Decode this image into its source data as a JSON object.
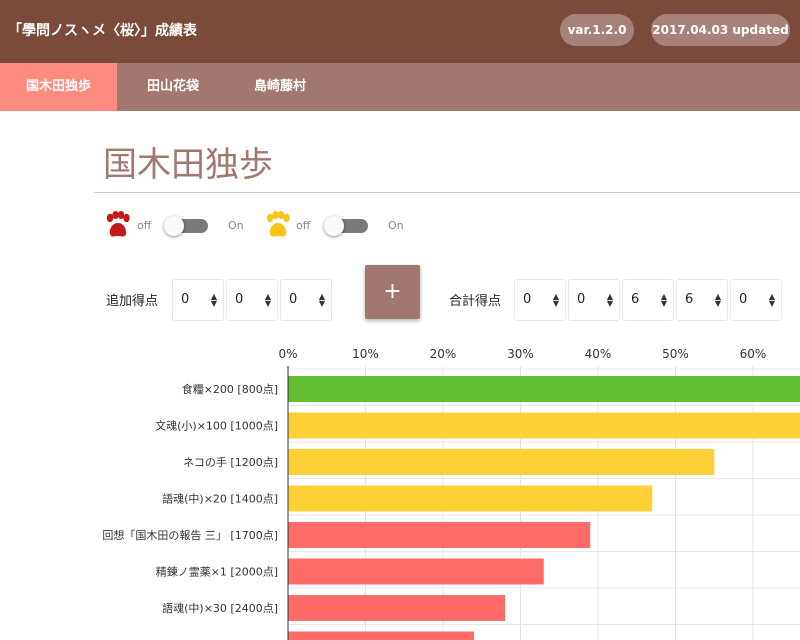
{
  "header": {
    "title": "「學問ノスヽメ〈桜〉」成績表",
    "version": "var.1.2.0",
    "updated": "2017.04.03 updated"
  },
  "tabs": [
    {
      "label": "国木田独歩",
      "active": true
    },
    {
      "label": "田山花袋",
      "active": false
    },
    {
      "label": "島崎藤村",
      "active": false
    }
  ],
  "page_title": "国木田独歩",
  "toggles": [
    {
      "icon": "paw-red-icon",
      "color": "#c41a1a",
      "off_label": "off",
      "on_label": "On",
      "state": "off"
    },
    {
      "icon": "paw-yellow-icon",
      "color": "#f5c518",
      "off_label": "off",
      "on_label": "On",
      "state": "off"
    }
  ],
  "add_score": {
    "label": "追加得点",
    "digits": [
      "0",
      "0",
      "0"
    ]
  },
  "add_button_label": "+",
  "total_score": {
    "label": "合計得点",
    "digits": [
      "0",
      "0",
      "6",
      "6",
      "0"
    ]
  },
  "colors": {
    "green": "#63bf33",
    "yellow": "#ffd036",
    "red": "#ff6b68",
    "header": "#7b4b3a",
    "tabs": "#a1776e",
    "active_tab": "#ff8a80"
  },
  "chart_data": {
    "type": "bar",
    "orientation": "horizontal",
    "x_ticks": [
      "0%",
      "10%",
      "20%",
      "30%",
      "40%",
      "50%",
      "60%"
    ],
    "xlim": [
      0,
      65
    ],
    "categories": [
      "食糧×200 [800点]",
      "文魂(小)×100 [1000点]",
      "ネコの手 [1200点]",
      "語魂(中)×20 [1400点]",
      "回想「国木田の報告 三」 [1700点]",
      "精錬ノ霊薬×1 [2000点]",
      "語魂(中)×30 [2400点]",
      ""
    ],
    "values": [
      82,
      70,
      55,
      47,
      39,
      33,
      28,
      24
    ],
    "bar_colors": [
      "#63bf33",
      "#ffd036",
      "#ffd036",
      "#ffd036",
      "#ff6b68",
      "#ff6b68",
      "#ff6b68",
      "#ff6b68"
    ],
    "grid": true
  }
}
